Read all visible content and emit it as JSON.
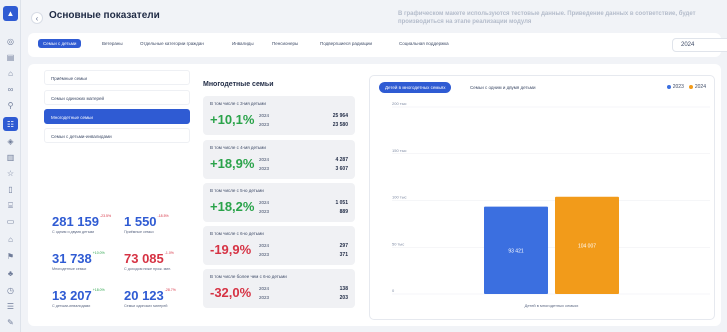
{
  "header": {
    "title": "Основные показатели",
    "notice": "В графическом макете используются тестовые данные. Приведение данных в соответствие, будет производиться на этапе реализации модуля"
  },
  "tabs": [
    "Семьи с детьми",
    "Ветераны",
    "Отдельные категории граждан",
    "Инвалиды",
    "Пенсионеры",
    "Подвергшиеся радиации",
    "Социальная поддержка"
  ],
  "year_select": {
    "value": "2024"
  },
  "categories": [
    "Приёмные семьи",
    "Семьи одиноких матерей",
    "Многодетные семьи",
    "Семьи с детьми-инвалидами"
  ],
  "stats": [
    {
      "value": "281 159",
      "pct": "-23.5%",
      "label": "С одним и двумя детьми",
      "color": "blue",
      "pct_color": "red"
    },
    {
      "value": "1 550",
      "pct": "-18.5%",
      "label": "Приёмные семьи",
      "color": "blue",
      "pct_color": "red"
    },
    {
      "value": "31 738",
      "pct": "+10.0%",
      "label": "Многодетные семьи",
      "color": "blue",
      "pct_color": "green"
    },
    {
      "value": "73 085",
      "pct": "-1.0%",
      "label": "С доходом ниже прож. мин.",
      "color": "red",
      "pct_color": "red"
    },
    {
      "value": "13 207",
      "pct": "+18.0%",
      "label": "С детьми-инвалидами",
      "color": "blue",
      "pct_color": "green"
    },
    {
      "value": "20 123",
      "pct": "-28.7%",
      "label": "Семьи одиноких матерей",
      "color": "blue",
      "pct_color": "red"
    }
  ],
  "mid": {
    "title": "Многодетные семьи",
    "cards": [
      {
        "title": "В том числе с 3-мя детьми",
        "change": "+10,1%",
        "trend": "up",
        "y1": "2024",
        "n1": "25 964",
        "y2": "2023",
        "n2": "23 580"
      },
      {
        "title": "В том числе с 4-мя детьми",
        "change": "+18,9%",
        "trend": "up",
        "y1": "2024",
        "n1": "4 287",
        "y2": "2023",
        "n2": "3 607"
      },
      {
        "title": "В том числе с 5-ю детьми",
        "change": "+18,2%",
        "trend": "up",
        "y1": "2024",
        "n1": "1 051",
        "y2": "2023",
        "n2": "889"
      },
      {
        "title": "В том числе с 6-ю детьми",
        "change": "-19,9%",
        "trend": "down",
        "y1": "2024",
        "n1": "297",
        "y2": "2023",
        "n2": "371"
      },
      {
        "title": "В том числе более чем с 6-ю детьми",
        "change": "-32,0%",
        "trend": "down",
        "y1": "2024",
        "n1": "138",
        "y2": "2023",
        "n2": "203"
      }
    ]
  },
  "chart_tabs": {
    "active": "Детей в многодетных семьях",
    "other": "Семьи с одним и двумя детьми"
  },
  "colors": {
    "accent": "#2f5bd3",
    "series_2023": "#3b6fe0",
    "series_2024": "#f29b1a",
    "up": "#2aa34a",
    "down": "#d63344"
  },
  "chart_data": {
    "type": "bar",
    "categories": [
      "Детей в многодетных семьях"
    ],
    "series": [
      {
        "name": "2023",
        "values": [
          93421
        ]
      },
      {
        "name": "2024",
        "values": [
          104007
        ]
      }
    ],
    "data_labels": [
      "93 421",
      "104 007"
    ],
    "yticks": [
      0,
      50000,
      100000,
      150000,
      200000
    ],
    "ytick_labels": [
      "0",
      "50 тыс",
      "100 тыс",
      "150 тыс",
      "200 тыс"
    ],
    "ylim": [
      0,
      200000
    ],
    "xlabel": "Детей в многодетных семьях",
    "grid": true,
    "legend": "top-right"
  }
}
